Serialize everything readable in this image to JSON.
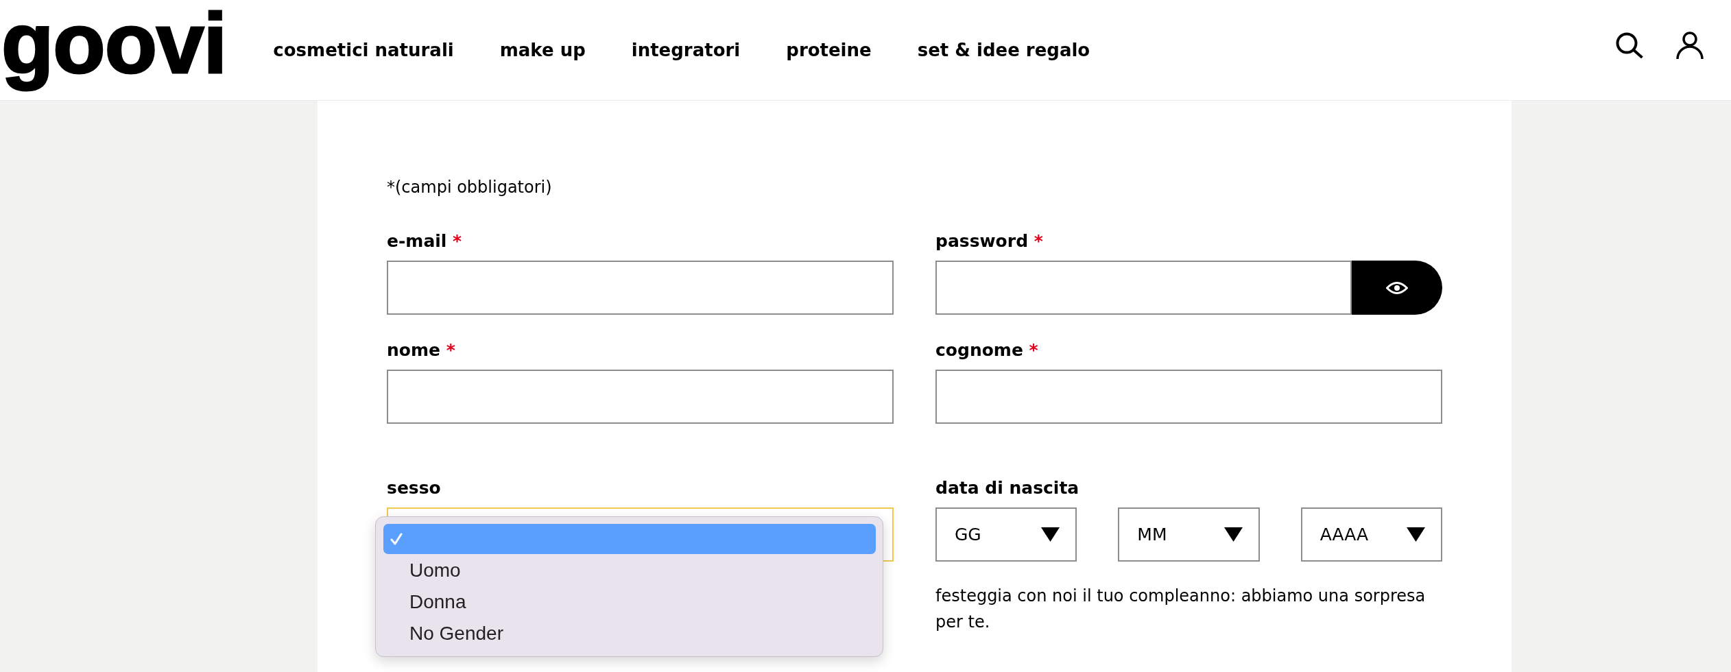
{
  "header": {
    "logo": "goovi",
    "nav": [
      "cosmetici naturali",
      "make up",
      "integratori",
      "proteine",
      "set & idee regalo"
    ]
  },
  "form": {
    "required_note": "*(campi obbligatori)",
    "fields": [
      {
        "kind": "text",
        "label": "e-mail",
        "required_mark": "*"
      },
      {
        "kind": "password",
        "label": "password",
        "required_mark": "*"
      },
      {
        "kind": "text",
        "label": "nome",
        "required_mark": "*"
      },
      {
        "kind": "text",
        "label": "cognome",
        "required_mark": "*"
      },
      {
        "kind": "select",
        "label": "sesso",
        "focused": true,
        "open": true,
        "options": [
          {
            "selected": true,
            "highlighted": true
          },
          {
            "label": "Uomo",
            "selected": false,
            "highlighted": false
          },
          {
            "label": "Donna",
            "selected": false,
            "highlighted": false
          },
          {
            "label": "No Gender",
            "selected": false,
            "highlighted": false
          }
        ]
      },
      {
        "kind": "date",
        "label": "data di nascita",
        "parts": [
          {
            "placeholder": "GG"
          },
          {
            "placeholder": "MM"
          },
          {
            "placeholder": "AAAA"
          }
        ],
        "note": "festeggia con noi il tuo compleanno: abbiamo una sorpresa per te."
      }
    ]
  }
}
